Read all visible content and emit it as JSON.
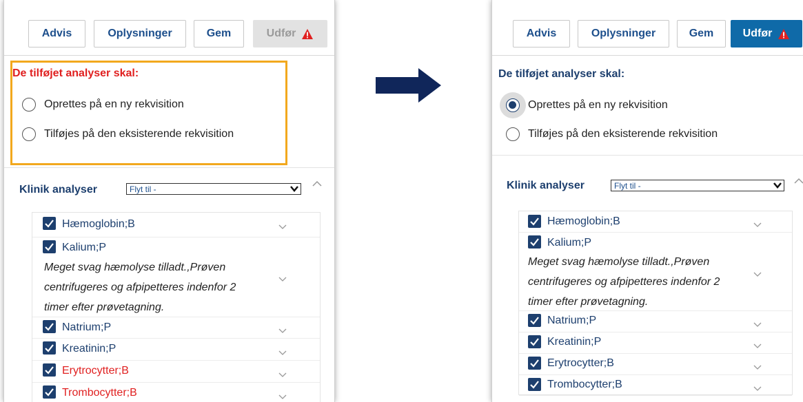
{
  "toolbar": {
    "advis": "Advis",
    "oplysninger": "Oplysninger",
    "gem": "Gem",
    "udfor": "Udfør"
  },
  "section": {
    "title": "De tilføjet analyser skal:",
    "option_new": "Oprettes på en ny rekvisition",
    "option_existing": "Tilføjes på den eksisterende rekvisition"
  },
  "clinic": {
    "title": "Klinik analyser",
    "move_to": "Flyt til -"
  },
  "analyses": [
    {
      "label": "Hæmoglobin;B"
    },
    {
      "label": "Kalium;P",
      "note": [
        "Meget svag hæmolyse tilladt.,Prøven",
        "centrifugeres og afpipetteres indenfor 2",
        "timer efter prøvetagning."
      ]
    },
    {
      "label": "Natrium;P"
    },
    {
      "label": "Kreatinin;P"
    },
    {
      "label": "Erytrocytter;B"
    },
    {
      "label": "Trombocytter;B"
    }
  ],
  "colors": {
    "title_red": "#e02020",
    "navy": "#1d3f6e",
    "primary_blue": "#0f6aa8",
    "highlight": "#f2a81d",
    "arrow": "#10265a"
  },
  "state": {
    "left": {
      "udfor_enabled": false,
      "selected_option": null,
      "highlight_section": true
    },
    "right": {
      "udfor_enabled": true,
      "selected_option": "new",
      "highlight_section": false
    }
  }
}
